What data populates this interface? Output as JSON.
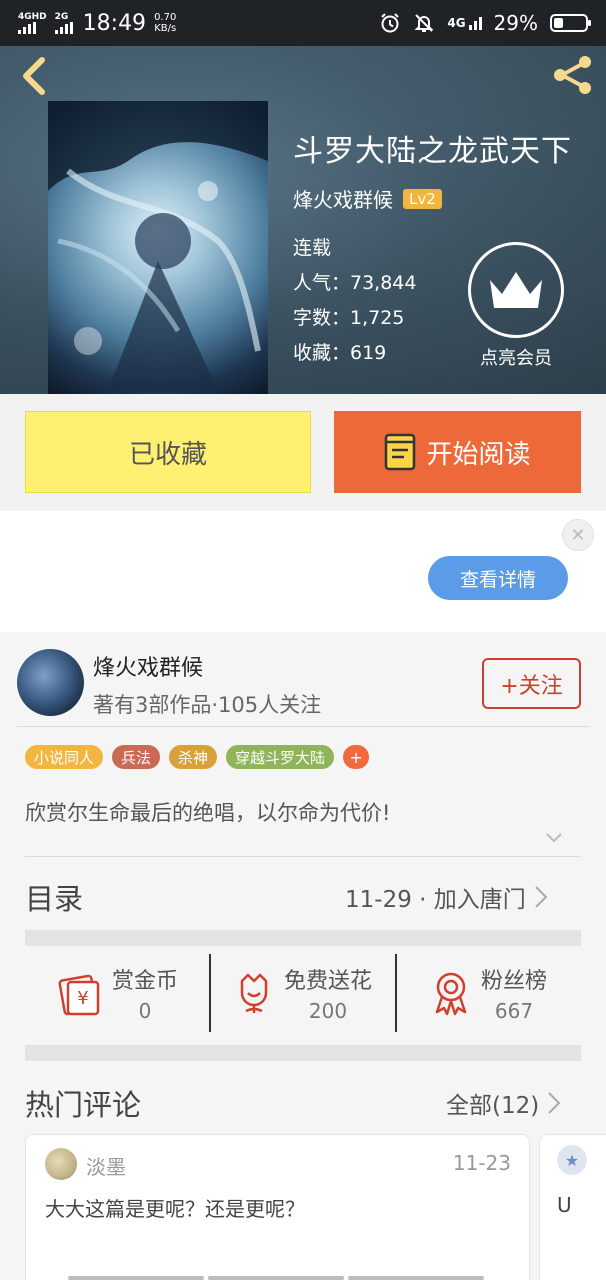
{
  "status_bar": {
    "network1": "4GHD",
    "network2": "2G",
    "time": "18:49",
    "speed_value": "0.70",
    "speed_unit": "KB/s",
    "network3": "4G",
    "battery": "29%",
    "battery_level": 0.29
  },
  "book": {
    "title": "斗罗大陆之龙武天下",
    "author": "烽火戏群候",
    "level": "Lv2",
    "status": "连载",
    "popularity": "人气：73,844",
    "words": "字数：1,725",
    "favorites": "收藏：619",
    "vip_label": "点亮会员"
  },
  "actions": {
    "collected_label": "已收藏",
    "read_label": "开始阅读"
  },
  "ad": {
    "close": "✕",
    "detail_label": "查看详情"
  },
  "author_card": {
    "name": "烽火戏群候",
    "stats": "著有3部作品·105人关注",
    "follow_label": "+关注"
  },
  "tags": [
    {
      "label": "小说同人",
      "color": "#f2b640"
    },
    {
      "label": "兵法",
      "color": "#c96a55"
    },
    {
      "label": "杀神",
      "color": "#d9a13a"
    },
    {
      "label": "穿越斗罗大陆",
      "color": "#8fb45a"
    }
  ],
  "tag_add": "+",
  "intro": "欣赏尔生命最后的绝唱，以尔命为代价!",
  "toc": {
    "title": "目录",
    "latest": "11-29 · 加入唐门"
  },
  "stats": {
    "reward_label": "赏金币",
    "reward_value": "0",
    "flower_label": "免费送花",
    "flower_value": "200",
    "fans_label": "粉丝榜",
    "fans_value": "667"
  },
  "comments": {
    "title": "热门评论",
    "all_label": "全部(12)",
    "items": [
      {
        "user": "淡墨",
        "date": "11-23",
        "text": "大大这篇是更呢？还是更呢？"
      },
      {
        "text": "U"
      }
    ]
  },
  "colors": {
    "accent": "#ee6939",
    "collected_bg": "#fdf073",
    "follow_red": "#c9412f",
    "detail_blue": "#5b9be7"
  }
}
